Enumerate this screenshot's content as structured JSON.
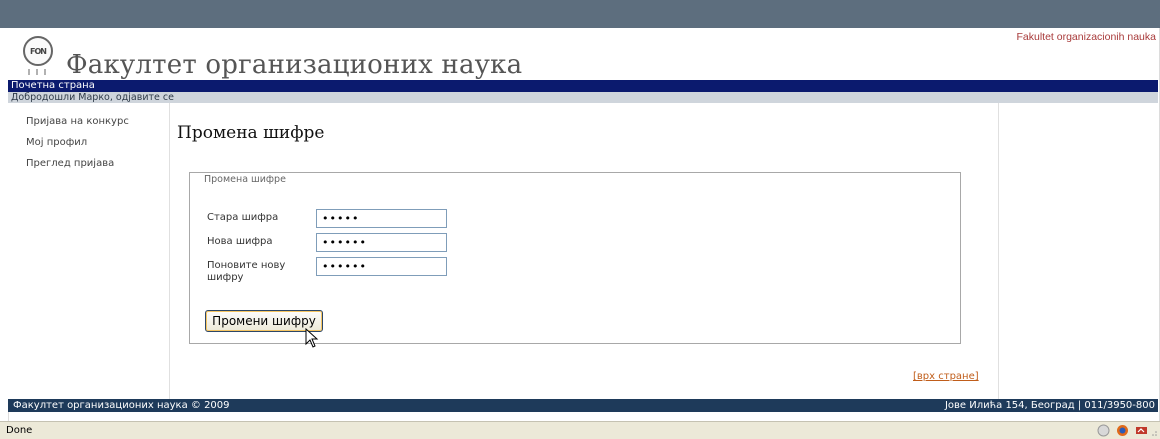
{
  "header": {
    "title": "Факултет организационих наука",
    "latin_name": "Fakultet organizacionih nauka",
    "logo_text": "FON"
  },
  "nav": {
    "home": "Почетна страна"
  },
  "welcome": {
    "text": "Добродошли Марко, одјавите се"
  },
  "sidebar": {
    "items": [
      {
        "label": "Пријава на конкурс"
      },
      {
        "label": "Мој профил"
      },
      {
        "label": "Преглед пријава"
      }
    ]
  },
  "main": {
    "title": "Промена шифре",
    "fieldset_legend": "Промена шифре",
    "fields": [
      {
        "label": "Стара шифра",
        "value": "•••••"
      },
      {
        "label": "Нова шифра",
        "value": "••••••"
      },
      {
        "label": "Поновите нову шифру",
        "value": "••••••"
      }
    ],
    "submit_label": "Промени шифру",
    "back_to_top": "[врх стране]"
  },
  "footer": {
    "left": "Факултет организационих наука © 2009",
    "right": "Јове Илића 154, Београд | 011/3950-800"
  },
  "statusbar": {
    "text": "Done"
  },
  "colors": {
    "navbar": "#0b1a6e",
    "footer": "#1e3a5a",
    "welcome_bar": "#cfd5dc",
    "top_chrome": "#5d6e7e",
    "link_accent": "#c05d1a",
    "latin_name": "#a83a3a"
  }
}
